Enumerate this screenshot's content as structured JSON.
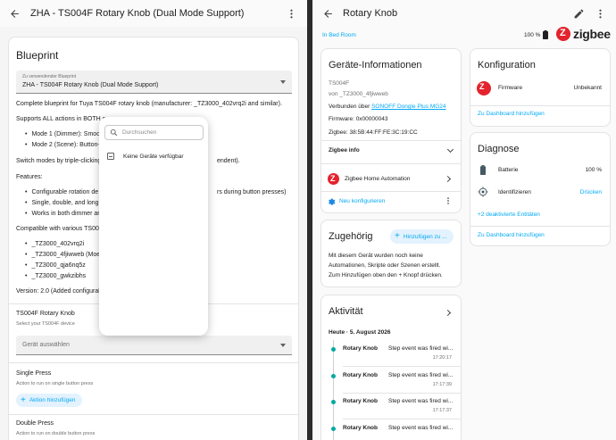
{
  "left": {
    "title": "ZHA - TS004F Rotary Knob (Dual Mode Support)",
    "heading": "Blueprint",
    "blueprint_field": {
      "label": "Zu verwendender Blueprint",
      "value": "ZHA - TS004F Rotary Knob (Dual Mode Support)"
    },
    "description": {
      "line1": "Complete blueprint for Tuya TS004F rotary knob (manufacturer: _TZ3000_402vrq2i and similar).",
      "line2": "Supports ALL actions in BOTH o",
      "mode1": "Mode 1 (Dimmer): Smoo",
      "mode2": "Mode 2 (Scene): Button-",
      "switch_text": "Switch modes by triple-clicking",
      "switch_tail": "endent).",
      "features_label": "Features:",
      "feature1": "Configurable rotation de",
      "feature1_tail": "rs during button presses)",
      "feature2": "Single, double, and long",
      "feature3": "Works in both dimmer ar",
      "compatible": "Compatible with various TS004",
      "models": [
        "_TZ3000_402vrq2i",
        "_TZ3000_4fjiwweb (Moe",
        "_TZ3000_qja6nq5z",
        "_TZ3000_gwkzibhs"
      ],
      "version": "Version: 2.0 (Added configurab"
    },
    "device_section": {
      "title": "TS004F Rotary Knob",
      "subtitle": "Select your TS004F device",
      "placeholder": "Gerät auswählen"
    },
    "single_press": {
      "title": "Single Press",
      "subtitle": "Action to run on single button press",
      "button": "Aktion hinzufügen"
    },
    "double_press": {
      "title": "Double Press",
      "subtitle": "Action to run on double button press"
    },
    "popup": {
      "search_placeholder": "Durchsuchen",
      "empty_text": "Keine Geräte verfügbar"
    }
  },
  "right": {
    "title": "Rotary Knob",
    "room": "In Bed Room",
    "battery": "100 %",
    "brand": "zigbee",
    "device_info": {
      "title": "Geräte-Informationen",
      "model": "TS004F",
      "by": "von _TZ3000_4fjiwweb",
      "connected_label": "Verbunden über",
      "connected_link": "SONOFF Dongle Plus MG24",
      "firmware": "Firmware: 0x00000043",
      "zigbee": "Zigbee: 38:5B:44:FF:FE:3C:19:CC",
      "zigbee_info": "Zigbee info",
      "integration": "Zigbee Home Automation",
      "reconfigure": "Neu konfigurieren"
    },
    "related": {
      "title": "Zugehörig",
      "add_button": "Hinzufügen zu ...",
      "text1": "Mit diesem Gerät wurden noch keine",
      "text2": "Automationen, Skripte oder Szenen erstellt.",
      "text3": "Zum Hinzufügen oben den + Knopf drücken."
    },
    "activity": {
      "title": "Aktivität",
      "date": "Heute · 5. August 2026",
      "entries": [
        {
          "name": "Rotary Knob",
          "msg": "Step event was fired wi...",
          "time": "17:20:17"
        },
        {
          "name": "Rotary Knob",
          "msg": "Step event was fired wi...",
          "time": "17:17:39"
        },
        {
          "name": "Rotary Knob",
          "msg": "Step event was fired wi...",
          "time": "17:17:37"
        },
        {
          "name": "Rotary Knob",
          "msg": "Step event was fired wi...",
          "time": ""
        }
      ]
    },
    "config": {
      "title": "Konfiguration",
      "firmware_label": "Firmware",
      "firmware_value": "Unbekannt",
      "dashboard_link": "Zu Dashboard hinzufügen"
    },
    "diagnose": {
      "title": "Diagnose",
      "battery_label": "Batterie",
      "battery_value": "100 %",
      "identify_label": "Identifizieren",
      "identify_action": "Drücken",
      "disabled_entities": "+2 deaktivierte Entitäten",
      "dashboard_link": "Zu Dashboard hinzufügen"
    }
  }
}
